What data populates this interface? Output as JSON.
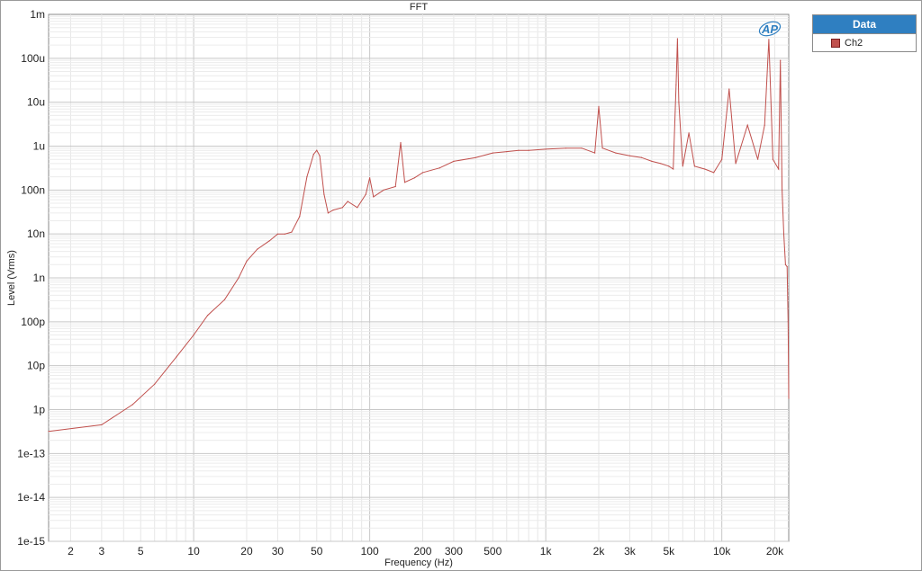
{
  "chart_data": {
    "type": "line",
    "title": "FFT",
    "xlabel": "Frequency (Hz)",
    "ylabel": "Level (Vrms)",
    "x_scale": "log",
    "y_scale": "log",
    "xlim": [
      1.5,
      24000
    ],
    "ylim": [
      1e-15,
      0.001
    ],
    "x_ticks": [
      {
        "value": 2,
        "label": "2"
      },
      {
        "value": 3,
        "label": "3"
      },
      {
        "value": 5,
        "label": "5"
      },
      {
        "value": 10,
        "label": "10"
      },
      {
        "value": 20,
        "label": "20"
      },
      {
        "value": 30,
        "label": "30"
      },
      {
        "value": 50,
        "label": "50"
      },
      {
        "value": 100,
        "label": "100"
      },
      {
        "value": 200,
        "label": "200"
      },
      {
        "value": 300,
        "label": "300"
      },
      {
        "value": 500,
        "label": "500"
      },
      {
        "value": 1000,
        "label": "1k"
      },
      {
        "value": 2000,
        "label": "2k"
      },
      {
        "value": 3000,
        "label": "3k"
      },
      {
        "value": 5000,
        "label": "5k"
      },
      {
        "value": 10000,
        "label": "10k"
      },
      {
        "value": 20000,
        "label": "20k"
      }
    ],
    "y_ticks": [
      {
        "value": 0.001,
        "label": "1m"
      },
      {
        "value": 0.0001,
        "label": "100u"
      },
      {
        "value": 1e-05,
        "label": "10u"
      },
      {
        "value": 1e-06,
        "label": "1u"
      },
      {
        "value": 1e-07,
        "label": "100n"
      },
      {
        "value": 1e-08,
        "label": "10n"
      },
      {
        "value": 1e-09,
        "label": "1n"
      },
      {
        "value": 1e-10,
        "label": "100p"
      },
      {
        "value": 1e-11,
        "label": "10p"
      },
      {
        "value": 1e-12,
        "label": "1p"
      },
      {
        "value": 1e-13,
        "label": "1e-13"
      },
      {
        "value": 1e-14,
        "label": "1e-14"
      },
      {
        "value": 1e-15,
        "label": "1e-15"
      }
    ],
    "grid": true,
    "legend_position": "top-right-outside",
    "legend_title": "Data",
    "series": [
      {
        "name": "Ch2",
        "color": "#c0504d",
        "points": [
          [
            1.5,
            3.2e-13
          ],
          [
            3,
            4.5e-13
          ],
          [
            4.5,
            1.3e-12
          ],
          [
            6,
            3.8e-12
          ],
          [
            8,
            1.6e-11
          ],
          [
            10,
            5e-11
          ],
          [
            12,
            1.4e-10
          ],
          [
            15,
            3.2e-10
          ],
          [
            18,
            1e-09
          ],
          [
            20,
            2.4e-09
          ],
          [
            23,
            4.5e-09
          ],
          [
            27,
            7e-09
          ],
          [
            30,
            1e-08
          ],
          [
            33,
            1e-08
          ],
          [
            36,
            1.1e-08
          ],
          [
            40,
            2.5e-08
          ],
          [
            44,
            2e-07
          ],
          [
            48,
            6.5e-07
          ],
          [
            50,
            8e-07
          ],
          [
            52,
            6e-07
          ],
          [
            55,
            8e-08
          ],
          [
            58,
            3e-08
          ],
          [
            62,
            3.5e-08
          ],
          [
            70,
            4e-08
          ],
          [
            75,
            5.5e-08
          ],
          [
            85,
            4e-08
          ],
          [
            95,
            8e-08
          ],
          [
            100,
            1.9e-07
          ],
          [
            105,
            7e-08
          ],
          [
            120,
            1e-07
          ],
          [
            140,
            1.2e-07
          ],
          [
            150,
            1.2e-06
          ],
          [
            158,
            1.5e-07
          ],
          [
            180,
            1.9e-07
          ],
          [
            200,
            2.5e-07
          ],
          [
            250,
            3.2e-07
          ],
          [
            300,
            4.5e-07
          ],
          [
            400,
            5.5e-07
          ],
          [
            500,
            7e-07
          ],
          [
            600,
            7.5e-07
          ],
          [
            700,
            8e-07
          ],
          [
            800,
            8e-07
          ],
          [
            1000,
            8.5e-07
          ],
          [
            1300,
            9e-07
          ],
          [
            1600,
            9e-07
          ],
          [
            1900,
            7e-07
          ],
          [
            2000,
            8e-06
          ],
          [
            2100,
            9e-07
          ],
          [
            2500,
            7e-07
          ],
          [
            3000,
            6e-07
          ],
          [
            3500,
            5.5e-07
          ],
          [
            4000,
            4.5e-07
          ],
          [
            4500,
            4e-07
          ],
          [
            5000,
            3.5e-07
          ],
          [
            5300,
            3e-07
          ],
          [
            5500,
            2.5e-05
          ],
          [
            5600,
            0.00028
          ],
          [
            5700,
            1e-05
          ],
          [
            6000,
            3.5e-07
          ],
          [
            6500,
            2e-06
          ],
          [
            7000,
            3.5e-07
          ],
          [
            8000,
            3e-07
          ],
          [
            9000,
            2.5e-07
          ],
          [
            10000,
            5e-07
          ],
          [
            11000,
            2e-05
          ],
          [
            12000,
            4e-07
          ],
          [
            14000,
            3e-06
          ],
          [
            16000,
            5e-07
          ],
          [
            17500,
            3e-06
          ],
          [
            18500,
            0.00027
          ],
          [
            19500,
            5e-07
          ],
          [
            21000,
            3e-07
          ],
          [
            21500,
            9e-05
          ],
          [
            22000,
            1e-07
          ],
          [
            22500,
            1e-08
          ],
          [
            23000,
            2e-09
          ],
          [
            23500,
            1.8e-09
          ],
          [
            23800,
            1e-10
          ],
          [
            24000,
            1.8e-12
          ]
        ]
      }
    ]
  }
}
